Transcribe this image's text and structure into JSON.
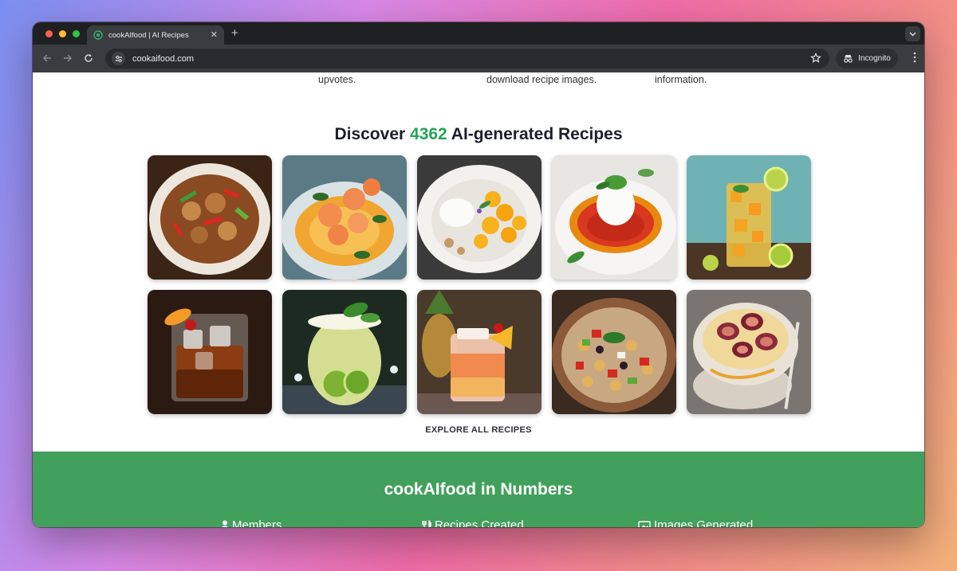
{
  "browser": {
    "tab_title": "cookAIfood | AI Recipes",
    "new_tab": "+",
    "url": "cookaifood.com",
    "incognito_label": "Incognito"
  },
  "features": {
    "col1": "upvotes.",
    "col2": "download recipe images.",
    "col3": "information."
  },
  "discover": {
    "prefix": "Discover ",
    "count": "4362",
    "suffix": " AI-generated Recipes"
  },
  "recipes": [
    {
      "image": "chicken-stir-fry-image"
    },
    {
      "image": "shrimp-dish-image"
    },
    {
      "image": "dessert-plate-image"
    },
    {
      "image": "burrata-tomato-image"
    },
    {
      "image": "mango-cocktail-image"
    },
    {
      "image": "whiskey-cocktail-image"
    },
    {
      "image": "lime-cocktail-image"
    },
    {
      "image": "pineapple-cocktail-image"
    },
    {
      "image": "chickpea-salad-image"
    },
    {
      "image": "fig-bowl-image"
    }
  ],
  "explore_label": "EXPLORE ALL RECIPES",
  "numbers": {
    "title": "cookAIfood in Numbers",
    "stats": [
      {
        "icon": "person-icon",
        "label": "Members"
      },
      {
        "icon": "utensils-icon",
        "label": "Recipes Created"
      },
      {
        "icon": "image-icon",
        "label": "Images Generated"
      }
    ]
  },
  "colors": {
    "accent_green": "#23a456",
    "numbers_bg": "#41a05b"
  }
}
